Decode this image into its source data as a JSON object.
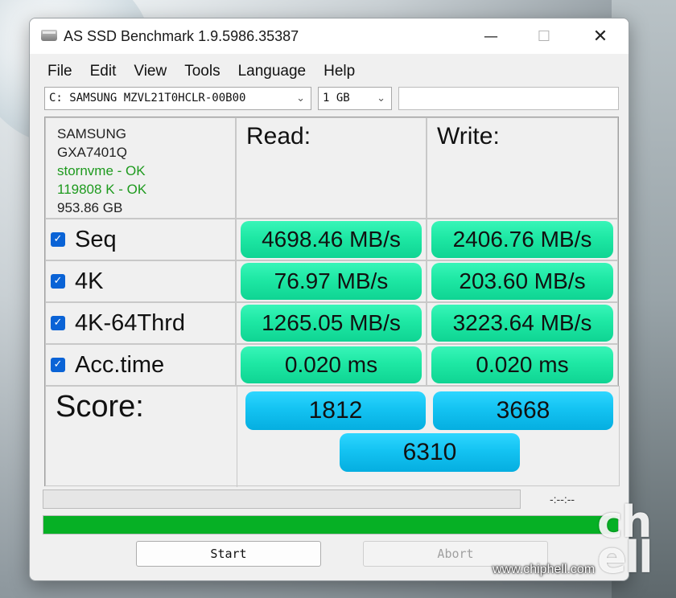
{
  "window": {
    "title": "AS SSD Benchmark 1.9.5986.35387",
    "controls": {
      "minimize": "—",
      "maximize": "☐",
      "close": "✕"
    }
  },
  "menu": [
    "File",
    "Edit",
    "View",
    "Tools",
    "Language",
    "Help"
  ],
  "toolbar": {
    "drive_select": "C: SAMSUNG MZVL21T0HCLR-00B00",
    "size_select": "1 GB",
    "text_field": ""
  },
  "drive_info": {
    "vendor": "SAMSUNG",
    "firmware": "GXA7401Q",
    "driver": "stornvme - OK",
    "alignment": "119808 K - OK",
    "capacity": "953.86 GB",
    "ok_color": "#1e9a1e"
  },
  "headers": {
    "read": "Read:",
    "write": "Write:"
  },
  "tests": [
    {
      "label": "Seq",
      "checked": true,
      "read": "4698.46 MB/s",
      "write": "2406.76 MB/s"
    },
    {
      "label": "4K",
      "checked": true,
      "read": "76.97 MB/s",
      "write": "203.60 MB/s"
    },
    {
      "label": "4K-64Thrd",
      "checked": true,
      "read": "1265.05 MB/s",
      "write": "3223.64 MB/s"
    },
    {
      "label": "Acc.time",
      "checked": true,
      "read": "0.020 ms",
      "write": "0.020 ms"
    }
  ],
  "score": {
    "label": "Score:",
    "read": "1812",
    "write": "3668",
    "total": "6310"
  },
  "status": {
    "time_label": "-:--:--",
    "progress_fraction": 0,
    "green_bar_fraction": 1.0
  },
  "buttons": {
    "start": "Start",
    "abort": "Abort"
  },
  "watermark": {
    "logo": "chip hell",
    "url": "www.chiphell.com"
  },
  "colors": {
    "result_green": "#1ee8a4",
    "score_blue": "#14c3f2",
    "progress_green": "#06b025",
    "checkbox": "#0a63d6"
  }
}
